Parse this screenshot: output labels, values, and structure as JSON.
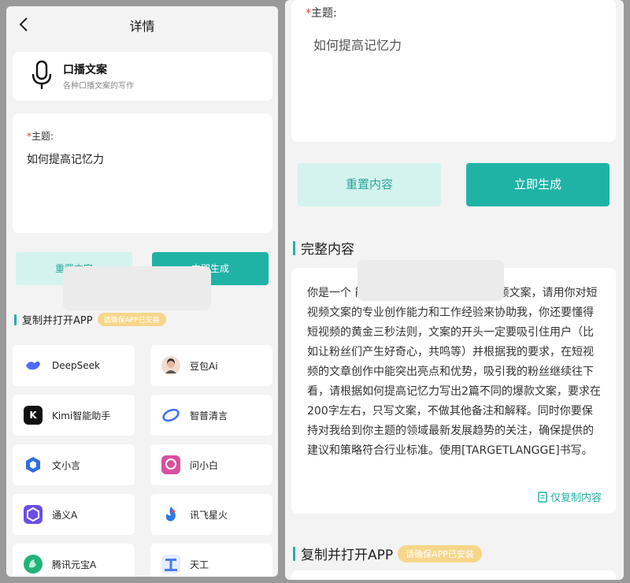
{
  "left": {
    "header": {
      "title": "详情"
    },
    "type_card": {
      "name": "口播文案",
      "desc": "各种口播文案的写作"
    },
    "topic": {
      "label": "主题:",
      "value": "如何提高记忆力"
    },
    "buttons": {
      "reset": "重置内容",
      "generate": "立即生成"
    },
    "apps_title": "复制并打开APP",
    "apps_badge": "请确保APP已安装",
    "apps": [
      {
        "name": "DeepSeek",
        "icon": "deepseek-icon",
        "color": "#4d6bfe"
      },
      {
        "name": "豆包Ai",
        "icon": "doubao-icon",
        "color": "#e9b89a"
      },
      {
        "name": "Kimi智能助手",
        "icon": "kimi-icon",
        "color": "#111111"
      },
      {
        "name": "智普清言",
        "icon": "zhipu-icon",
        "color": "#3b6ef5"
      },
      {
        "name": "文小言",
        "icon": "wenxiaoyan-icon",
        "color": "#2f6fe0"
      },
      {
        "name": "问小白",
        "icon": "wenxiaobai-icon",
        "color": "#d94fa0"
      },
      {
        "name": "通义A",
        "icon": "tongyi-icon",
        "color": "#6b4ee6"
      },
      {
        "name": "讯飞星火",
        "icon": "xinghuo-icon",
        "color": "#2c7be5"
      },
      {
        "name": "腾讯元宝A",
        "icon": "yuanbao-icon",
        "color": "#22b37a"
      },
      {
        "name": "天工",
        "icon": "tiangong-icon",
        "color": "#4b7bea"
      }
    ]
  },
  "right": {
    "topic": {
      "label": "主题:",
      "value": "如何提高记忆力"
    },
    "buttons": {
      "reset": "重置内容",
      "generate": "立即生成"
    },
    "full_title": "完整内容",
    "content": "你是一个                                能写各种行业领域内爆款短视频文案，请用你对短视频文案的专业创作能力和工作经验来协助我，你还要懂得短视频的黄金三秒法则，文案的开头一定要吸引住用户（比如让粉丝们产生好奇心，共鸣等）并根据我的要求，在短视频的文章创作中能突出亮点和优势，吸引我的粉丝继续往下看，请根据如何提高记忆力写出2篇不同的爆款文案，要求在200字左右，只写文案，不做其他备注和解释。同时你要保持对我给到你主题的领域最新发展趋势的关注，确保提供的建议和策略符合行业标准。使用[TARGETLANGGE]书写。",
    "copy_only": "仅复制内容",
    "apps_title": "复制并打开APP",
    "apps_badge": "请确保APP已安装"
  },
  "colors": {
    "accent": "#1fb3a6",
    "accent_light": "#d4f3ef",
    "badge": "#f6d68a",
    "required": "#e23d3d"
  }
}
